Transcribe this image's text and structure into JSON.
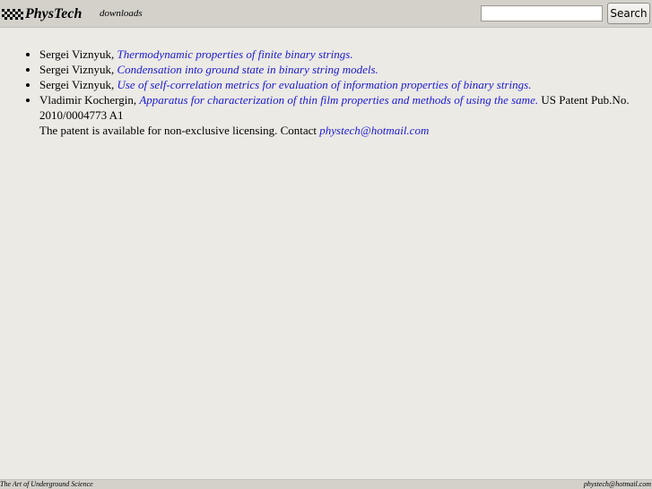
{
  "header": {
    "logo_text": "PhysTech",
    "logo_icon": "checkered-dots-icon",
    "nav_link": "downloads",
    "search": {
      "value": "",
      "placeholder": "",
      "button_label": "Search"
    }
  },
  "publications": [
    {
      "author": "Sergei Viznyuk, ",
      "title": "Thermodynamic properties of finite binary strings.",
      "after": ""
    },
    {
      "author": "Sergei Viznyuk, ",
      "title": "Condensation into ground state in binary string models.",
      "after": ""
    },
    {
      "author": "Sergei Viznyuk, ",
      "title": "Use of self-correlation metrics for evaluation of information properties of binary strings.",
      "after": ""
    },
    {
      "author": "Vladimir Kochergin, ",
      "title": "Apparatus for characterization of thin film properties and methods of using the same.",
      "after": " US Patent Pub.No. 2010/0004773 A1",
      "contact_text": "The patent is available for non-exclusive licensing. Contact ",
      "contact_email": "phystech@hotmail.com"
    }
  ],
  "footer": {
    "left": "The Art of Underground Science",
    "right": "phystеch@hotmail.com"
  },
  "colors": {
    "background": "#eceae5",
    "bar": "#d4d1cb",
    "link": "#1a1ad4"
  }
}
